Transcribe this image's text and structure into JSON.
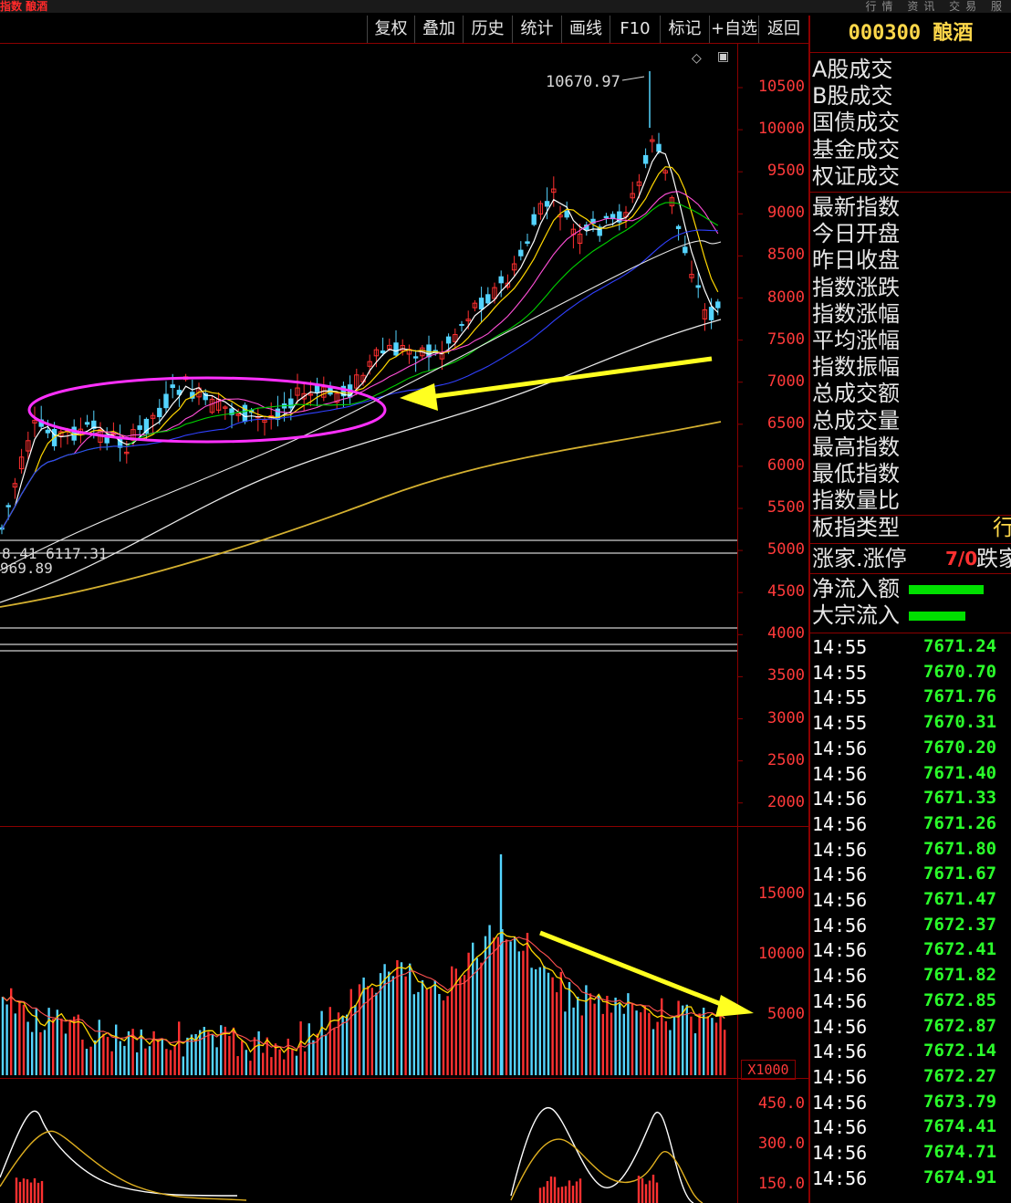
{
  "top_strip": {
    "title": "指数 酿酒",
    "right_tabs": "行情 资讯 交易 服"
  },
  "toolbar": {
    "buttons": [
      "复权",
      "叠加",
      "历史",
      "统计",
      "画线",
      "F10",
      "标记",
      "+自选",
      "返回"
    ]
  },
  "security": {
    "code_name": "000300 酿酒"
  },
  "price_axis": [
    "10500",
    "10000",
    "9500",
    "9000",
    "8500",
    "8000",
    "7500",
    "7000",
    "6500",
    "6000",
    "5500",
    "5000",
    "4500",
    "4000",
    "3500",
    "3000",
    "2500",
    "2000"
  ],
  "volume_axis": [
    "15000",
    "10000",
    "5000"
  ],
  "volume_unit": "X1000",
  "indicator_axis": [
    "450.0",
    "300.0",
    "150.0"
  ],
  "annotations": {
    "high_label": "10670.97",
    "left_label_1": "8.41  6117.31",
    "left_label_2": "969.89"
  },
  "sidebar": {
    "labels_a": [
      "A股成交",
      "B股成交",
      "国债成交",
      "基金成交",
      "权证成交"
    ],
    "labels_b": [
      "最新指数",
      "今日开盘",
      "昨日收盘",
      "指数涨跌",
      "指数涨幅",
      "平均涨幅",
      "指数振幅",
      "总成交额",
      "总成交量",
      "最高指数",
      "最低指数",
      "指数量比"
    ],
    "sector_type": "板指类型",
    "sector_type_value": "行",
    "up_limit": "涨家.涨停",
    "up_limit_value": "7/0",
    "down_label": "跌家",
    "net_inflow": "净流入额",
    "block_inflow": "大宗流入"
  },
  "ticks": [
    {
      "t": "14:55",
      "v": "7671.24"
    },
    {
      "t": "14:55",
      "v": "7670.70"
    },
    {
      "t": "14:55",
      "v": "7671.76"
    },
    {
      "t": "14:55",
      "v": "7670.31"
    },
    {
      "t": "14:56",
      "v": "7670.20"
    },
    {
      "t": "14:56",
      "v": "7671.40"
    },
    {
      "t": "14:56",
      "v": "7671.33"
    },
    {
      "t": "14:56",
      "v": "7671.26"
    },
    {
      "t": "14:56",
      "v": "7671.80"
    },
    {
      "t": "14:56",
      "v": "7671.67"
    },
    {
      "t": "14:56",
      "v": "7671.47"
    },
    {
      "t": "14:56",
      "v": "7672.37"
    },
    {
      "t": "14:56",
      "v": "7672.41"
    },
    {
      "t": "14:56",
      "v": "7671.82"
    },
    {
      "t": "14:56",
      "v": "7672.85"
    },
    {
      "t": "14:56",
      "v": "7672.87"
    },
    {
      "t": "14:56",
      "v": "7672.14"
    },
    {
      "t": "14:56",
      "v": "7672.27"
    },
    {
      "t": "14:56",
      "v": "7673.79"
    },
    {
      "t": "14:56",
      "v": "7674.41"
    },
    {
      "t": "14:56",
      "v": "7674.71"
    },
    {
      "t": "14:56",
      "v": "7674.91"
    }
  ],
  "colors": {
    "up": "#ff3030",
    "down": "#54d4ff",
    "ma5": "#ffffff",
    "ma10": "#ffd700",
    "ma20": "#ff4fd8",
    "ma30": "#00d000",
    "ma60": "#3040ff",
    "ma120": "#e8e8e8",
    "ma250": "#d4b030",
    "ellipse": "#ff30ff",
    "arrow": "#ffff20",
    "tick_value": "#2bff2b"
  }
}
